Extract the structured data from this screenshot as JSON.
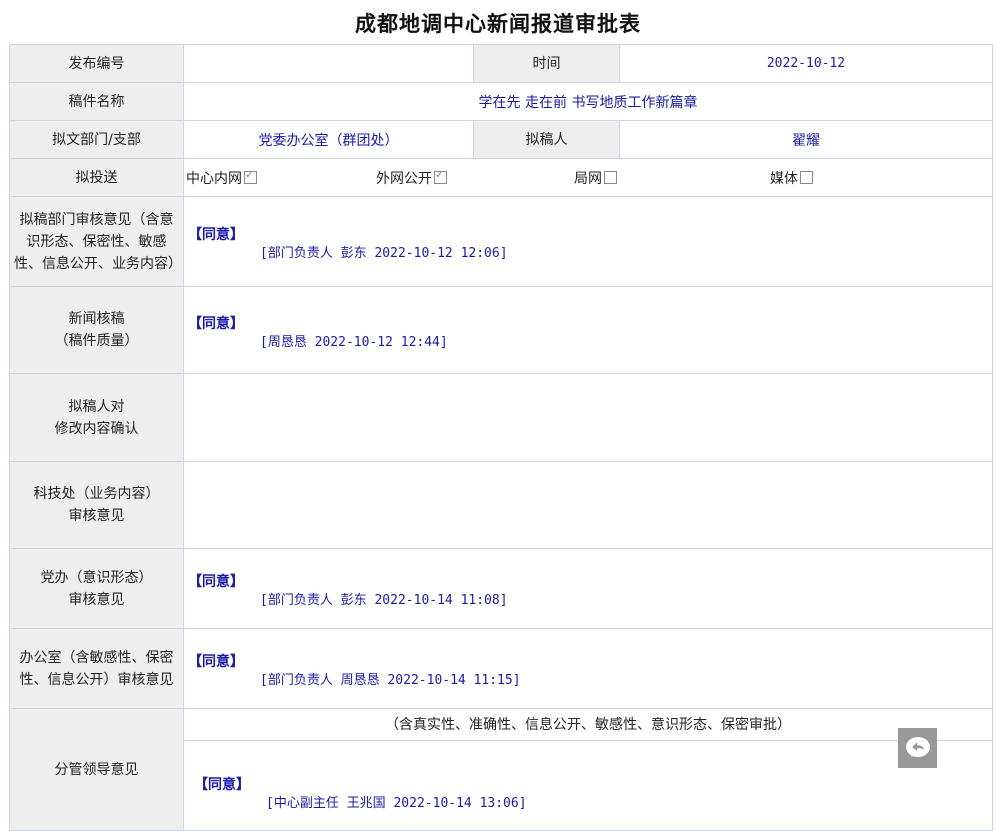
{
  "title": "成都地调中心新闻报道审批表",
  "rows": {
    "release_no_label": "发布编号",
    "release_no_value": "",
    "time_label": "时间",
    "time_value": "2022-10-12",
    "manuscript_name_label": "稿件名称",
    "manuscript_name_value": "学在先 走在前 书写地质工作新篇章",
    "dept_label": "拟文部门/支部",
    "dept_value": "党委办公室（群团处）",
    "drafter_label": "拟稿人",
    "drafter_value": "翟耀",
    "send_label": "拟投送",
    "send_options": [
      {
        "label": "中心内网",
        "checked": true
      },
      {
        "label": "外网公开",
        "checked": true
      },
      {
        "label": "局网",
        "checked": false
      },
      {
        "label": "媒体",
        "checked": false
      }
    ],
    "dept_review_label": "拟稿部门审核意见（含意识形态、保密性、敏感性、信息公开、业务内容）",
    "dept_review_agree": "【同意】",
    "dept_review_sig": "[部门负责人 彭东 2022-10-12 12:06]",
    "news_review_label_1": "新闻核稿",
    "news_review_label_2": "（稿件质量）",
    "news_review_agree": "【同意】",
    "news_review_sig": "[周恳恳 2022-10-12 12:44]",
    "drafter_confirm_label_1": "拟稿人对",
    "drafter_confirm_label_2": "修改内容确认",
    "tech_review_label_1": "科技处（业务内容）",
    "tech_review_label_2": "审核意见",
    "party_review_label_1": "党办（意识形态）",
    "party_review_label_2": "审核意见",
    "party_review_agree": "【同意】",
    "party_review_sig": "[部门负责人 彭东 2022-10-14 11:08]",
    "office_review_label": "办公室（含敏感性、保密性、信息公开）审核意见",
    "office_review_agree": "【同意】",
    "office_review_sig": "[部门负责人 周恳恳 2022-10-14 11:15]",
    "leader_label": "分管领导意见",
    "leader_note": "（含真实性、准确性、信息公开、敏感性、意识形态、保密审批）",
    "leader_agree": "【同意】",
    "leader_sig": "[中心副主任 王兆国 2022-10-14 13:06]"
  }
}
